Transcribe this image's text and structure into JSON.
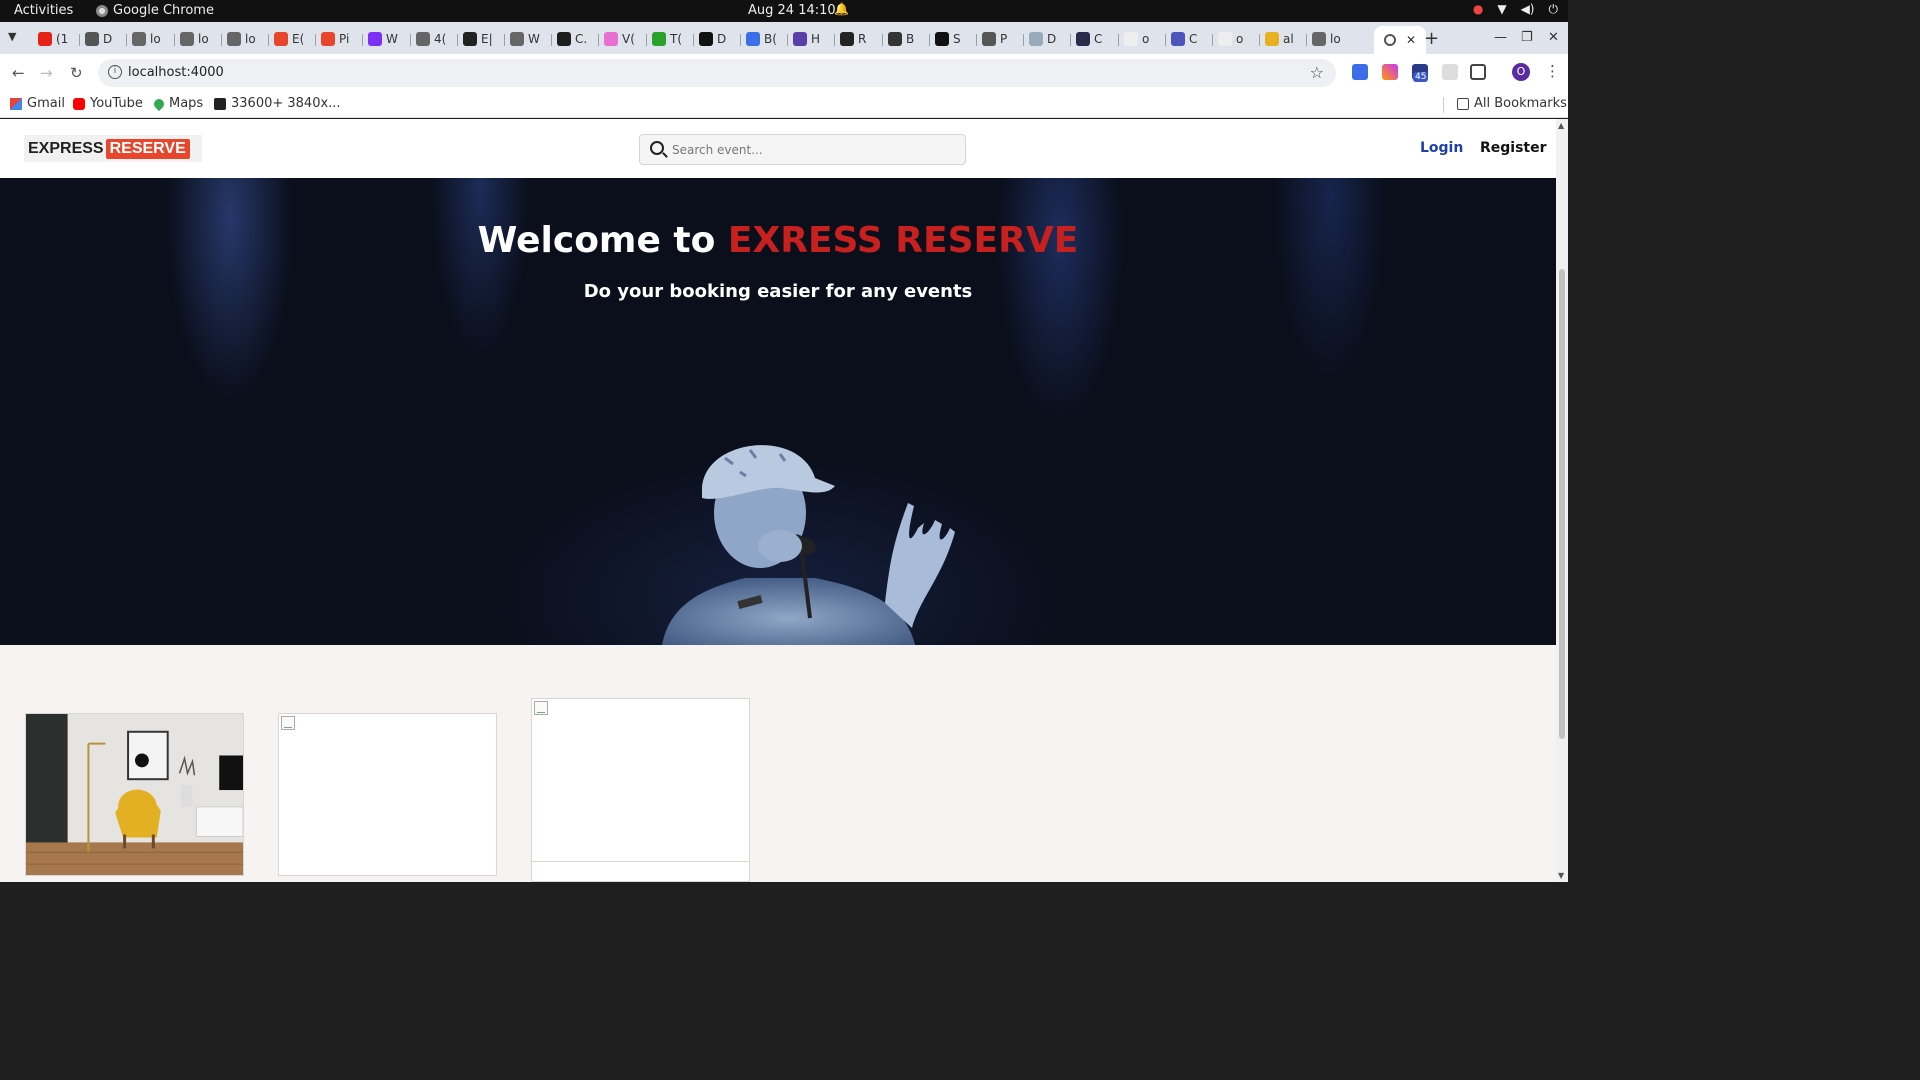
{
  "system_bar": {
    "activities": "Activities",
    "app_name": "Google Chrome",
    "datetime": "Aug 24  14:10"
  },
  "tabs": [
    {
      "label": "(1",
      "color": "#e62117"
    },
    {
      "label": "D",
      "color": "#555555"
    },
    {
      "label": "lo",
      "color": "#666666"
    },
    {
      "label": "lo",
      "color": "#666666"
    },
    {
      "label": "lo",
      "color": "#666666"
    },
    {
      "label": "E(",
      "color": "#e8462c"
    },
    {
      "label": "Pi",
      "color": "#e8462c"
    },
    {
      "label": "W",
      "color": "#7b2ff7"
    },
    {
      "label": "4(",
      "color": "#666666"
    },
    {
      "label": "E|",
      "color": "#222222"
    },
    {
      "label": "W",
      "color": "#666666"
    },
    {
      "label": "C.",
      "color": "#1d1d1d"
    },
    {
      "label": "V(",
      "color": "#e76fcf"
    },
    {
      "label": "T(",
      "color": "#2aa12a"
    },
    {
      "label": "D",
      "color": "#111111"
    },
    {
      "label": "B(",
      "color": "#3b6ee8"
    },
    {
      "label": "H",
      "color": "#5b3fa8"
    },
    {
      "label": "R",
      "color": "#222222"
    },
    {
      "label": "B",
      "color": "#333333"
    },
    {
      "label": "S",
      "color": "#111111"
    },
    {
      "label": "P",
      "color": "#555555"
    },
    {
      "label": "D",
      "color": "#9ab"
    },
    {
      "label": "C",
      "color": "#2a2a4a"
    },
    {
      "label": "o",
      "color": "#eeeeee"
    },
    {
      "label": "C",
      "color": "#4b53bc"
    },
    {
      "label": "o",
      "color": "#eeeeee"
    },
    {
      "label": "al",
      "color": "#e8b020"
    },
    {
      "label": "lo",
      "color": "#666666"
    }
  ],
  "active_tab": {
    "label": "",
    "close": "✕"
  },
  "toolbar": {
    "url": "localhost:4000"
  },
  "bookmarks": {
    "items": [
      "Gmail",
      "YouTube",
      "Maps",
      "33600+ 3840x..."
    ],
    "all": "All Bookmarks"
  },
  "extensions": {
    "badge": "45",
    "avatar_letter": "O"
  },
  "site": {
    "logo_part1": "EXPRESS",
    "logo_part2": "RESERVE",
    "search_placeholder": "Search event...",
    "login": "Login",
    "register": "Register"
  },
  "hero": {
    "title_prefix": "Welcome to ",
    "title_accent": "EXRESS RESERVE",
    "subtitle": "Do your booking easier for any events"
  },
  "colors": {
    "accent_red": "#c8201f",
    "logo_red": "#e8462c",
    "login_blue": "#1f3fa8"
  }
}
